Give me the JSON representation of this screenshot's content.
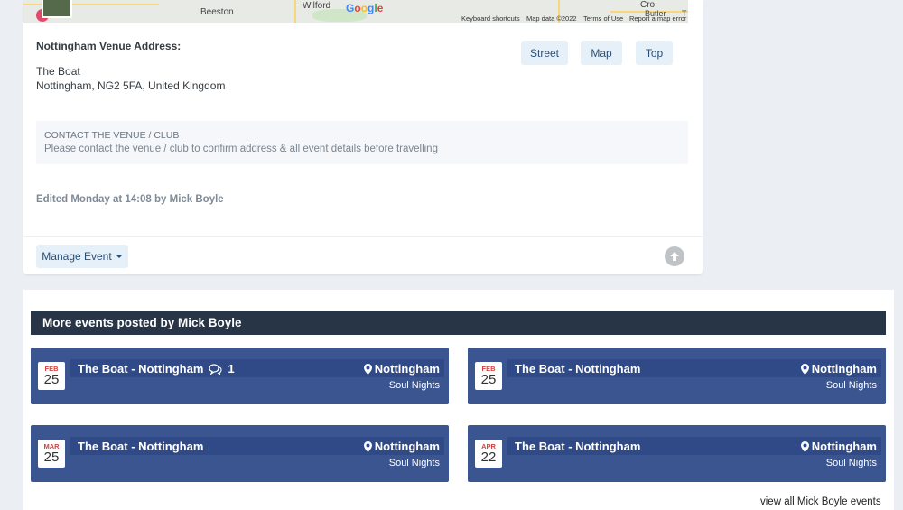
{
  "map": {
    "labels": [
      "Beeston",
      "Wilford",
      "Cro",
      "Butler",
      "T"
    ],
    "footer": [
      "Keyboard shortcuts",
      "Map data ©2022",
      "Terms of Use",
      "Report a map error"
    ],
    "google": [
      "G",
      "o",
      "o",
      "g",
      "l",
      "e"
    ]
  },
  "venue": {
    "heading": "Nottingham Venue Address:",
    "name": "The Boat",
    "address": "Nottingham, NG2 5FA, United Kingdom"
  },
  "map_buttons": {
    "street": "Street",
    "map": "Map",
    "top": "Top"
  },
  "notice": {
    "title": "CONTACT THE VENUE / CLUB",
    "text": "Please contact the venue / club to confirm address & all event details before travelling"
  },
  "edited": "Edited Monday at 14:08 by Mick Boyle",
  "manage": {
    "label": "Manage Event"
  },
  "more_events": {
    "heading": "More events posted by Mick Boyle",
    "events": [
      {
        "month": "FEB",
        "day": "25",
        "title": "The Boat - Nottingham",
        "comments": "1",
        "location": "Nottingham",
        "category": "Soul Nights"
      },
      {
        "month": "FEB",
        "day": "25",
        "title": "The Boat - Nottingham",
        "location": "Nottingham",
        "category": "Soul Nights"
      },
      {
        "month": "MAR",
        "day": "25",
        "title": "The Boat - Nottingham",
        "location": "Nottingham",
        "category": "Soul Nights"
      },
      {
        "month": "APR",
        "day": "22",
        "title": "The Boat - Nottingham",
        "location": "Nottingham",
        "category": "Soul Nights"
      }
    ],
    "view_all": "view all Mick Boyle events"
  },
  "colors": {
    "header_bg": "#283547",
    "event_bg": "#3b5590",
    "button_bg": "#e6f0f8"
  }
}
